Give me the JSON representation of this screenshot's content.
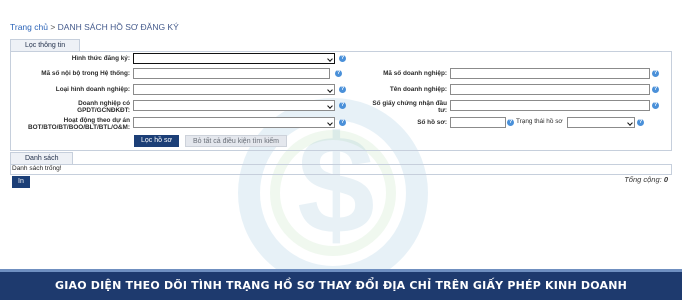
{
  "breadcrumb": {
    "home": "Trang chủ",
    "separator": " > ",
    "current": "DANH SÁCH HỒ SƠ ĐĂNG KÝ"
  },
  "filter": {
    "tab_label": "Lọc thông tin",
    "fields": {
      "hinh_thuc": "Hình thức đăng ký:",
      "ma_so_noi_bo": "Mã số nội bộ trong Hệ thống:",
      "loai_hinh": "Loại hình doanh nghiệp:",
      "dn_co_gpdt_line1": "Doanh nghiệp có",
      "dn_co_gpdt_line2": "GPDT/GCNĐKĐT:",
      "hoat_dong_line1": "Hoạt động theo dự án",
      "hoat_dong_line2": "BOT/BTO/BT/BOO/BLT/BTL/O&M:",
      "ma_so_dn": "Mã số doanh nghiệp:",
      "ten_dn": "Tên doanh nghiệp:",
      "so_giay_line1": "Số giấy chứng nhận đầu",
      "so_giay_line2": "tư:",
      "so_ho_so": "Số hồ sơ:",
      "trang_thai": "Trạng thái hồ sơ"
    },
    "buttons": {
      "search": "Lọc hồ sơ",
      "clear": "Bỏ tất cả điều kiện tìm kiếm"
    },
    "help_glyph": "?"
  },
  "list": {
    "tab_label": "Danh sách",
    "empty_text": "Danh sách trống!",
    "total_label": "Tổng cộng:",
    "total_value": "0",
    "print_button": "In"
  },
  "banner": {
    "text": "GIAO DIỆN THEO DÕI TÌNH TRẠNG HỒ SƠ THAY ĐỔI ĐỊA CHỈ TRÊN GIẤY PHÉP KINH DOANH"
  },
  "colors": {
    "banner_bg": "#1e3a6e",
    "primary_button": "#1c3f77",
    "help_icon": "#4a90d9",
    "link": "#2a63b8"
  },
  "watermark_icon": "dollar-coin-logo"
}
